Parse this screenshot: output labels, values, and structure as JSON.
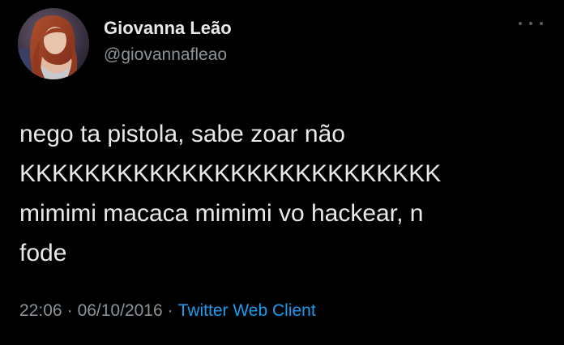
{
  "author": {
    "display_name": "Giovanna Leão",
    "handle": "@giovannafleao"
  },
  "tweet": {
    "lines": [
      "nego ta pistola, sabe zoar não",
      "KKKKKKKKKKKKKKKKKKKKKKKKKK",
      "mimimi macaca mimimi vo hackear, n",
      "fode"
    ]
  },
  "meta": {
    "time": "22:06",
    "separator_1": "·",
    "date": "06/10/2016",
    "separator_2": "·",
    "source": "Twitter Web Client"
  },
  "colors": {
    "background": "#000000",
    "text": "#e7e9ea",
    "secondary_text": "#8b9298",
    "link": "#1d9bf0"
  },
  "icons": {
    "more": "more-horizontal-icon",
    "avatar": "user-avatar"
  }
}
